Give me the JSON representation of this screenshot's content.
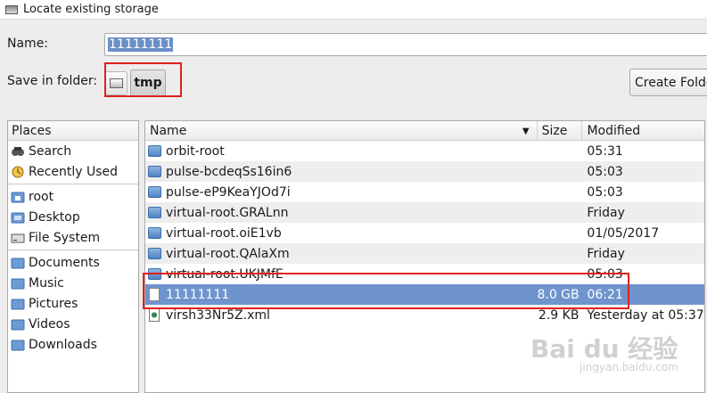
{
  "window": {
    "title": "Locate existing storage"
  },
  "name_field": {
    "label": "Name:",
    "value": "11111111"
  },
  "save_in": {
    "label": "Save in folder:",
    "current": "tmp",
    "root_icon": "drive-icon"
  },
  "create_folder_label": "Create Folde",
  "places": {
    "header": "Places",
    "groups": [
      [
        {
          "label": "Search",
          "icon": "search-icon"
        },
        {
          "label": "Recently Used",
          "icon": "recent-icon"
        }
      ],
      [
        {
          "label": "root",
          "icon": "home-folder-icon"
        },
        {
          "label": "Desktop",
          "icon": "desktop-icon"
        },
        {
          "label": "File System",
          "icon": "drive-icon"
        }
      ],
      [
        {
          "label": "Documents",
          "icon": "folder-icon"
        },
        {
          "label": "Music",
          "icon": "folder-icon"
        },
        {
          "label": "Pictures",
          "icon": "folder-icon"
        },
        {
          "label": "Videos",
          "icon": "folder-icon"
        },
        {
          "label": "Downloads",
          "icon": "folder-icon"
        }
      ]
    ]
  },
  "files": {
    "columns": {
      "name": "Name",
      "size": "Size",
      "modified": "Modified"
    },
    "rows": [
      {
        "name": "orbit-root",
        "size": "",
        "modified": "05:31",
        "type": "folder"
      },
      {
        "name": "pulse-bcdeqSs16in6",
        "size": "",
        "modified": "05:03",
        "type": "folder"
      },
      {
        "name": "pulse-eP9KeaYJOd7i",
        "size": "",
        "modified": "05:03",
        "type": "folder"
      },
      {
        "name": "virtual-root.GRALnn",
        "size": "",
        "modified": "Friday",
        "type": "folder"
      },
      {
        "name": "virtual-root.oiE1vb",
        "size": "",
        "modified": "01/05/2017",
        "type": "folder"
      },
      {
        "name": "virtual-root.QAlaXm",
        "size": "",
        "modified": "Friday",
        "type": "folder"
      },
      {
        "name": "virtual-root.UKJMfE",
        "size": "",
        "modified": "05:03",
        "type": "folder"
      },
      {
        "name": "11111111",
        "size": "8.0 GB",
        "modified": "06:21",
        "type": "file",
        "selected": true
      },
      {
        "name": "virsh33Nr5Z.xml",
        "size": "2.9 KB",
        "modified": "Yesterday at 05:37",
        "type": "xml"
      }
    ]
  },
  "watermark": {
    "text": "Bai du 经验",
    "sub": "jingyan.baidu.com"
  },
  "colors": {
    "selection": "#6f94cd",
    "highlight_box": "#e0201c"
  }
}
